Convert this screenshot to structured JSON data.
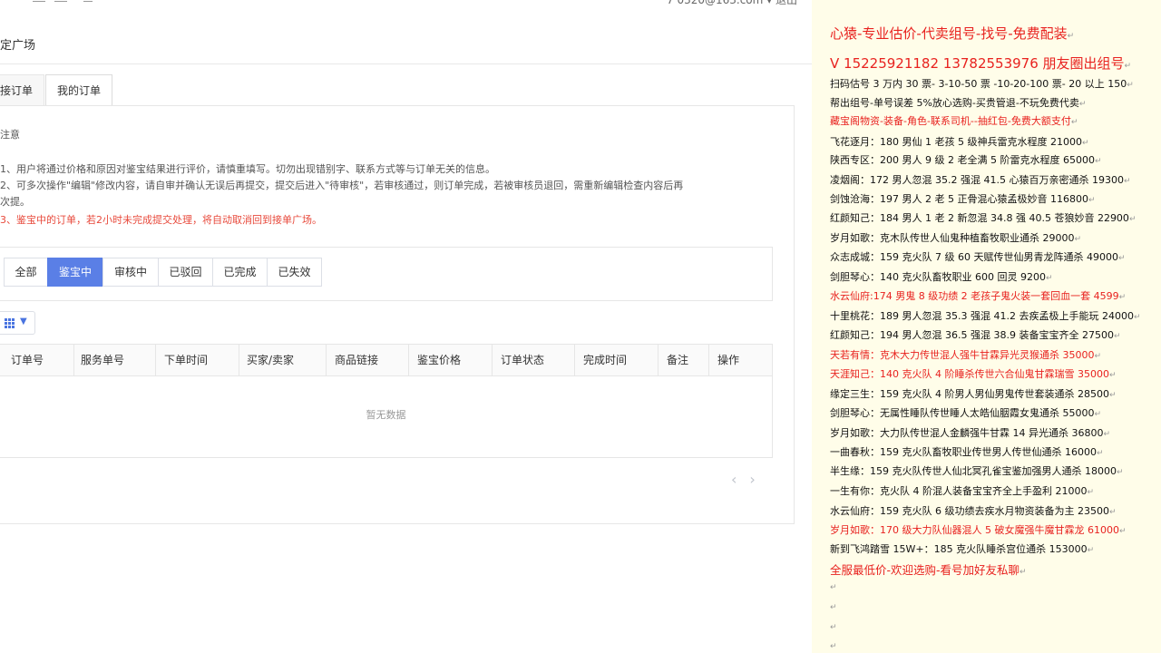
{
  "header": {
    "user": "7 0320@163.com ▾  退出",
    "page_title": "定广场"
  },
  "tabs": [
    {
      "label": "接订单"
    },
    {
      "label": "我的订单"
    }
  ],
  "notice": {
    "title": "注意",
    "lines": [
      "1、用户将通过价格和原因对鉴宝结果进行评价，请慎重填写。切勿出现错别字、联系方式等与订单无关的信息。",
      "2、可多次操作\"编辑\"修改内容，请自审并确认无误后再提交，提交后进入\"待审核\"，若审核通过，则订单完成，若被审核员退回，需重新编辑检查内容后再",
      "次提。",
      "3、鉴宝中的订单，若2小时未完成提交处理，将自动取消回到接单广场。"
    ]
  },
  "filters": [
    {
      "label": "全部"
    },
    {
      "label": "鉴宝中"
    },
    {
      "label": "审核中"
    },
    {
      "label": "已驳回"
    },
    {
      "label": "已完成"
    },
    {
      "label": "已失效"
    }
  ],
  "table": {
    "columns": [
      "订单号",
      "服务单号",
      "下单时间",
      "买家/卖家",
      "商品链接",
      "鉴宝价格",
      "订单状态",
      "完成时间",
      "备注",
      "操作"
    ],
    "empty": "暂无数据"
  },
  "pager": {
    "prev": "‹",
    "next": "›"
  },
  "ad": {
    "lines": [
      {
        "text": "心猿-专业估价-代卖组号-找号-免费配装",
        "style": "big"
      },
      {
        "text": "V 15225921182    13782553976 朋友圈出组号",
        "style": "big"
      },
      {
        "text": "扫码估号 3 万内 30 票- 3-10-50 票  -10-20-100 票- 20 以上 150",
        "style": "normal"
      },
      {
        "text": "帮出组号-单号误差 5%放心选购-买贵管退-不玩免费代卖",
        "style": "normal"
      },
      {
        "text": "藏宝阁物资-装备-角色-联系司机--抽红包-免费大额支付",
        "style": "red"
      },
      {
        "text": "飞花逐月：180 男仙 1 老孩 5 级神兵雷克水程度 21000",
        "style": "normal"
      },
      {
        "text": "陕西专区：200 男人 9 级 2 老全满 5 阶雷克水程度 65000",
        "style": "normal"
      },
      {
        "text": "凌烟阁：172 男人忽混 35.2 强混 41.5 心猿百万亲密通杀 19300",
        "style": "normal"
      },
      {
        "text": "剑蚀沧海：197 男人 2 老 5 正骨混心猿孟极妙音 116800",
        "style": "normal"
      },
      {
        "text": "红颜知己：184 男人 1 老 2 新忽混 34.8 强 40.5 苍狼妙音 22900",
        "style": "normal"
      },
      {
        "text": "岁月如歌：克木队传世人仙鬼种植畜牧职业通杀 29000",
        "style": "normal"
      },
      {
        "text": "众志成城：159 克火队 7 级 60 天赋传世仙男青龙阵通杀 49000",
        "style": "normal"
      },
      {
        "text": "剑胆琴心：140 克火队畜牧职业 600 回灵 9200",
        "style": "normal"
      },
      {
        "text": "水云仙府:174 男鬼 8 级功绩 2 老孩子鬼火装一套回血一套 4599",
        "style": "red"
      },
      {
        "text": "十里桃花：189 男人忽混 35.3 强混 41.2 去疾孟极上手能玩 24000",
        "style": "normal"
      },
      {
        "text": "红颜知己：194 男人忽混 36.5 强混 38.9 装备宝宝齐全 27500",
        "style": "normal"
      },
      {
        "text": "天若有情：克木大力传世混人强牛甘霖异光灵猴通杀 35000",
        "style": "red"
      },
      {
        "text": "天涯知己：140 克火队 4 阶睡杀传世六合仙鬼甘霖瑞雪 35000",
        "style": "red"
      },
      {
        "text": "缘定三生：159 克火队 4 阶男人男仙男鬼传世套装通杀 28500",
        "style": "normal"
      },
      {
        "text": "剑胆琴心：无属性睡队传世睡人太皓仙胭霞女鬼通杀 55000",
        "style": "normal"
      },
      {
        "text": "岁月如歌：大力队传世混人金麟强牛甘霖 14 异光通杀 36800",
        "style": "normal"
      },
      {
        "text": "一曲春秋：159 克火队畜牧职业传世男人传世仙通杀 16000",
        "style": "normal"
      },
      {
        "text": "半生缘：159 克火队传世人仙北冥孔雀宝鉴加强男人通杀 18000",
        "style": "normal"
      },
      {
        "text": "一生有你：克火队 4 阶混人装备宝宝齐全上手盈利 21000",
        "style": "normal"
      },
      {
        "text": "水云仙府：159 克火队 6 级功绩去疾水月物资装备为主 23500",
        "style": "normal"
      },
      {
        "text": "岁月如歌：170 级大力队仙器混人 5 破女魔强牛魔甘霖龙 61000",
        "style": "red"
      },
      {
        "text": "新到飞鸿踏雪 15W+：185 克火队睡杀宫位通杀 153000",
        "style": "normal"
      },
      {
        "text": "全服最低价-欢迎选购-看号加好友私聊",
        "style": "red-mid"
      },
      {
        "text": "",
        "style": "normal"
      },
      {
        "text": "",
        "style": "normal"
      },
      {
        "text": "",
        "style": "normal"
      },
      {
        "text": "",
        "style": "normal"
      }
    ],
    "return_mark": "↵"
  },
  "colors": {
    "primary": "#5a7fe6",
    "ad_red": "#e8221f",
    "ad_bg": "#fffde9",
    "notice_red": "#e84a3c"
  }
}
